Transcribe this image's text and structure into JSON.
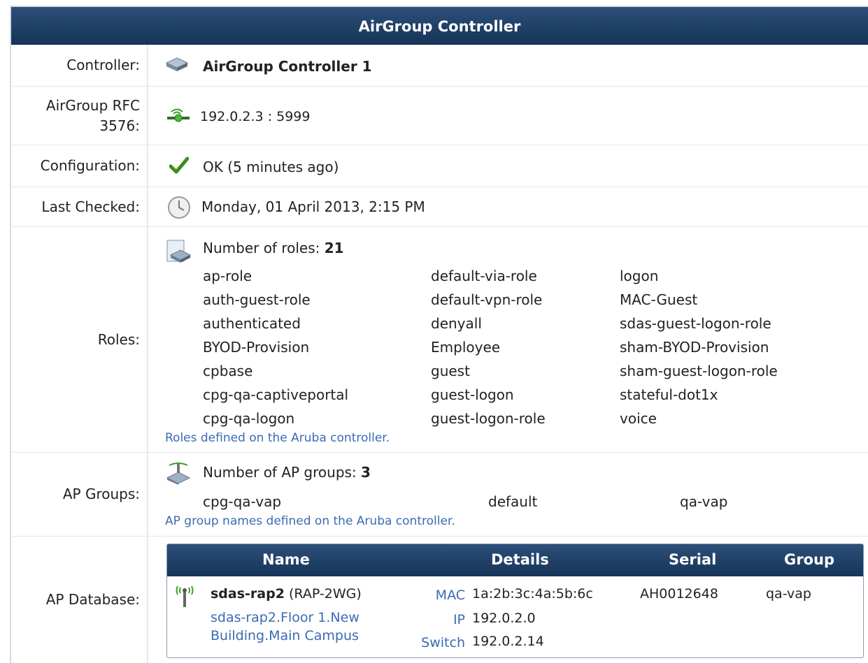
{
  "panel": {
    "title": "AirGroup Controller"
  },
  "controller": {
    "label": "Controller:",
    "value": "AirGroup Controller 1",
    "icon": "server-icon"
  },
  "rfc": {
    "label_line1": "AirGroup RFC",
    "label_line2": "3576:",
    "value": "192.0.2.3 : 5999",
    "icon": "network-connection-icon"
  },
  "configuration": {
    "label": "Configuration:",
    "value": "OK (5 minutes ago)",
    "icon": "checkmark-icon",
    "status_color": "#3c8d1f"
  },
  "last_checked": {
    "label": "Last Checked:",
    "value": "Monday, 01 April 2013, 2:15 PM",
    "icon": "clock-icon"
  },
  "roles": {
    "label": "Roles:",
    "count_label": "Number of roles:",
    "count": "21",
    "icon": "roles-icon",
    "items": [
      "ap-role",
      "default-via-role",
      "logon",
      "auth-guest-role",
      "default-vpn-role",
      "MAC-Guest",
      "authenticated",
      "denyall",
      "sdas-guest-logon-role",
      "BYOD-Provision",
      "Employee",
      "sham-BYOD-Provision",
      "cpbase",
      "guest",
      "sham-guest-logon-role",
      "cpg-qa-captiveportal",
      "guest-logon",
      "stateful-dot1x",
      "cpg-qa-logon",
      "guest-logon-role",
      "voice"
    ],
    "note": "Roles defined on the Aruba controller."
  },
  "ap_groups": {
    "label": "AP Groups:",
    "count_label": "Number of AP groups:",
    "count": "3",
    "icon": "ap-groups-icon",
    "items": [
      "cpg-qa-vap",
      "default",
      "qa-vap"
    ],
    "note": "AP group names defined on the Aruba controller."
  },
  "ap_database": {
    "label": "AP Database:",
    "columns": {
      "name": "Name",
      "details": "Details",
      "serial": "Serial",
      "group": "Group"
    },
    "rows": [
      {
        "name": "sdas-rap2",
        "model": "(RAP-2WG)",
        "location_line1": "sdas-rap2.Floor 1.New",
        "location_line2": "Building.Main Campus",
        "mac_label": "MAC",
        "mac": "1a:2b:3c:4a:5b:6c",
        "ip_label": "IP",
        "ip": "192.0.2.0",
        "switch_label": "Switch",
        "switch": "192.0.2.14",
        "serial": "AH0012648",
        "group": "qa-vap",
        "icon": "access-point-icon"
      }
    ]
  },
  "colors": {
    "header_bg": "#1f3f66",
    "link": "#3a6bb3",
    "ok": "#3c8d1f"
  }
}
